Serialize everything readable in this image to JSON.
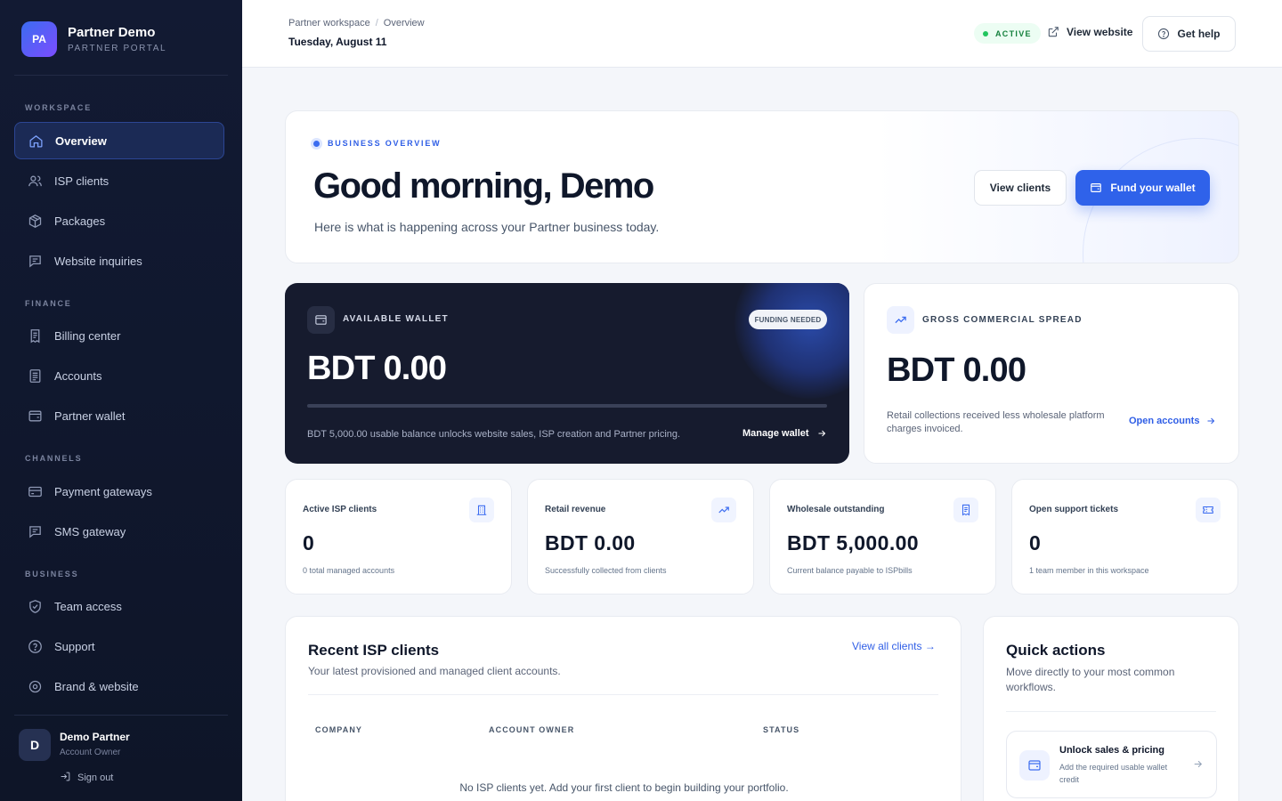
{
  "brand": {
    "initials": "PA",
    "name": "Partner Demo",
    "subtitle": "PARTNER PORTAL"
  },
  "sidebar": {
    "sections": {
      "workspace": "WORKSPACE",
      "finance": "FINANCE",
      "channels": "CHANNELS",
      "business": "BUSINESS"
    },
    "items": {
      "overview": "Overview",
      "isp_clients": "ISP clients",
      "packages": "Packages",
      "website_inquiries": "Website inquiries",
      "billing_center": "Billing center",
      "accounts": "Accounts",
      "partner_wallet": "Partner wallet",
      "payment_gateways": "Payment gateways",
      "sms_gateway": "SMS gateway",
      "team_access": "Team access",
      "support": "Support",
      "brand_website": "Brand & website"
    },
    "user": {
      "initial": "D",
      "name": "Demo Partner",
      "role": "Account Owner",
      "signout": "Sign out"
    }
  },
  "topbar": {
    "breadcrumb": [
      "Partner workspace",
      "Overview"
    ],
    "date": "Tuesday, August 11",
    "status": "ACTIVE",
    "view_website": "View website",
    "get_help": "Get help"
  },
  "hero": {
    "tag": "BUSINESS OVERVIEW",
    "title": "Good morning, Demo",
    "subtitle": "Here is what is happening across your Partner business today.",
    "view_clients": "View clients",
    "fund_wallet": "Fund your wallet"
  },
  "wallet": {
    "label": "AVAILABLE WALLET",
    "badge": "FUNDING NEEDED",
    "amount": "BDT 0.00",
    "progress": 0,
    "note": "BDT 5,000.00 usable balance unlocks website sales, ISP creation and Partner pricing.",
    "manage": "Manage wallet"
  },
  "spread": {
    "label": "GROSS COMMERCIAL SPREAD",
    "amount": "BDT 0.00",
    "note": "Retail collections received less wholesale platform charges invoiced.",
    "link": "Open accounts"
  },
  "stats": [
    {
      "label": "Active ISP clients",
      "value": "0",
      "note": "0 total managed accounts"
    },
    {
      "label": "Retail revenue",
      "value": "BDT 0.00",
      "note": "Successfully collected from clients"
    },
    {
      "label": "Wholesale outstanding",
      "value": "BDT 5,000.00",
      "note": "Current balance payable to ISPbills"
    },
    {
      "label": "Open support tickets",
      "value": "0",
      "note": "1 team member in this workspace"
    }
  ],
  "recent": {
    "title": "Recent ISP clients",
    "subtitle": "Your latest provisioned and managed client accounts.",
    "view_all": "View all clients →",
    "columns": [
      "COMPANY",
      "ACCOUNT OWNER",
      "STATUS"
    ],
    "empty": "No ISP clients yet. Add your first client to begin building your portfolio."
  },
  "quick": {
    "title": "Quick actions",
    "subtitle": "Move directly to your most common workflows.",
    "items": [
      {
        "title": "Unlock sales & pricing",
        "desc": "Add the required usable wallet credit"
      }
    ]
  }
}
